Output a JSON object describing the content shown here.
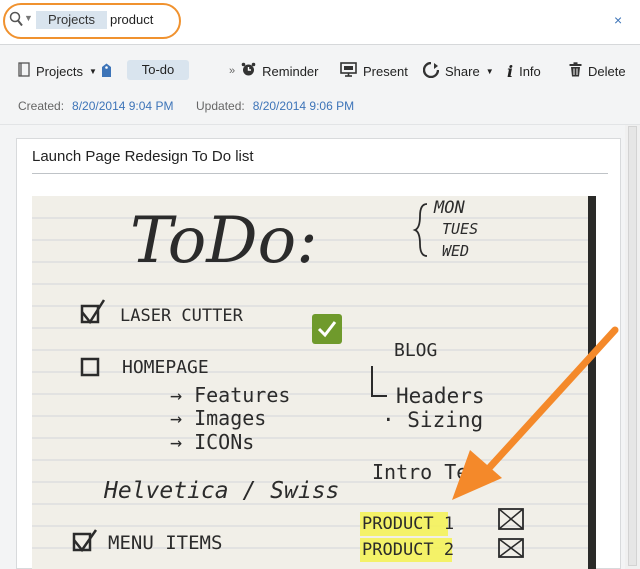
{
  "search": {
    "token": "Projects",
    "query": "product",
    "clear_symbol": "×"
  },
  "toolbar": {
    "notebook_label": "Projects",
    "tag_label": "To-do",
    "reminder_label": "Reminder",
    "present_label": "Present",
    "share_label": "Share",
    "info_label": "Info",
    "delete_label": "Delete"
  },
  "meta": {
    "created_label": "Created:",
    "created_value": "8/20/2014 9:04 PM",
    "updated_label": "Updated:",
    "updated_value": "8/20/2014 9:06 PM"
  },
  "note": {
    "title": "Launch Page Redesign To Do list",
    "handwriting": {
      "heading": "ToDo:",
      "days": [
        "MON",
        "TUES",
        "WED"
      ],
      "items": [
        "LASER CUTTER",
        "HOMEPAGE",
        "Features",
        "Images",
        "ICONs",
        "Helvetica / Swiss",
        "MENU ITEMS"
      ],
      "right_items": [
        "BLOG",
        "Headers",
        "· Sizing",
        "Intro Te"
      ],
      "products": [
        "PRODUCT 1",
        "PRODUCT 2"
      ]
    }
  },
  "colors": {
    "accent": "#3d74b8",
    "highlight_oval": "#f0922f",
    "arrow": "#f4892a",
    "check_green": "#6f9a2c",
    "marker_yellow": "#f4f25a"
  }
}
